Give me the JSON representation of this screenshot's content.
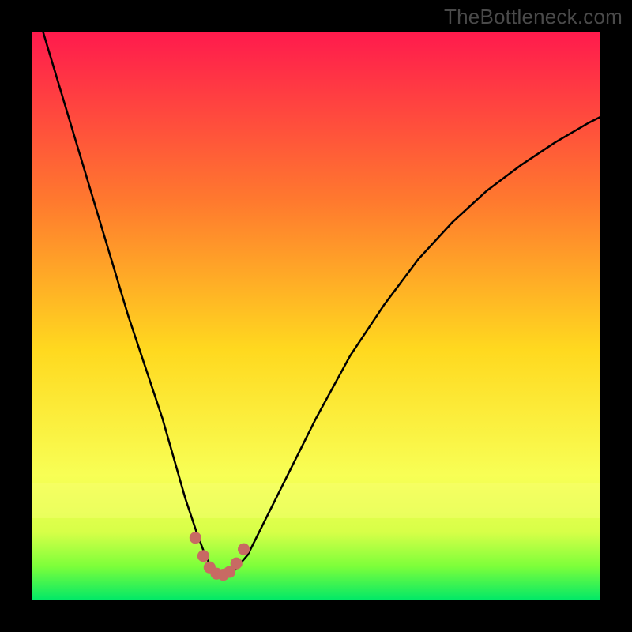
{
  "watermark": "TheBottleneck.com",
  "chart_data": {
    "type": "line",
    "title": "",
    "xlabel": "",
    "ylabel": "",
    "xlim": [
      0,
      100
    ],
    "ylim": [
      0,
      100
    ],
    "series": [
      {
        "name": "bottleneck-curve",
        "x": [
          2,
          5,
          8,
          11,
          14,
          17,
          20,
          23,
          25,
          27,
          29,
          30.5,
          32,
          33.5,
          35,
          38,
          41,
          45,
          50,
          56,
          62,
          68,
          74,
          80,
          86,
          92,
          98,
          100
        ],
        "values": [
          100,
          90,
          80,
          70,
          60,
          50,
          41,
          32,
          25,
          18,
          12,
          8,
          5,
          4,
          4.5,
          8,
          14,
          22,
          32,
          43,
          52,
          60,
          66.5,
          72,
          76.5,
          80.5,
          84,
          85
        ]
      }
    ],
    "marker_points": {
      "name": "highlight-dots",
      "x": [
        28.8,
        30.2,
        31.3,
        32.5,
        33.7,
        34.8,
        36.0,
        37.3
      ],
      "values": [
        11.0,
        7.8,
        5.8,
        4.7,
        4.5,
        5.0,
        6.5,
        9.0
      ]
    },
    "gradient": {
      "top": "#ff1a4d",
      "mid_upper": "#ff7a2e",
      "mid": "#ffd91f",
      "mid_lower": "#f8ff55",
      "band": "#d7ff48",
      "lower": "#7dff3a",
      "bottom": "#00e868"
    },
    "curve_color": "#000000",
    "marker_color": "#c86a63"
  }
}
